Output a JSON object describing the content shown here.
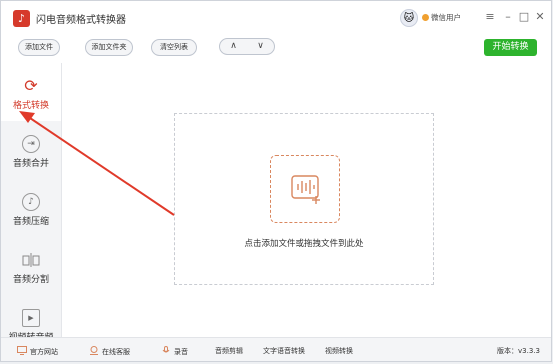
{
  "app": {
    "title": "闪电音频格式转换器"
  },
  "user": {
    "name": "微信用户"
  },
  "window_controls": {
    "menu": "≡",
    "minimize": "–",
    "maximize": "□",
    "close": "✕"
  },
  "toolbar": {
    "add_file": "添加文件",
    "add_folder": "添加文件夹",
    "clear_list": "清空列表",
    "up": "∧",
    "down": "∨",
    "start": "开始转换"
  },
  "sidebar": {
    "items": [
      {
        "label": "格式转换",
        "icon": "refresh-icon",
        "active": true
      },
      {
        "label": "音频合并",
        "icon": "merge-icon",
        "active": false
      },
      {
        "label": "音频压缩",
        "icon": "compress-icon",
        "active": false
      },
      {
        "label": "音频分割",
        "icon": "split-icon",
        "active": false
      },
      {
        "label": "视频转音频",
        "icon": "video-play-icon",
        "active": false
      }
    ]
  },
  "main": {
    "drop_hint": "点击添加文件或拖拽文件到此处"
  },
  "footer": {
    "website": "官方网站",
    "support": "在线客服",
    "record": "录音",
    "audio_edit": "音频剪辑",
    "tts": "文字语音转换",
    "video_convert": "视频转换",
    "version_label": "版本：v3.3.3"
  },
  "colors": {
    "accent_red": "#d23a2a",
    "start_green": "#2db32d",
    "drop_orange": "#d9875f"
  }
}
